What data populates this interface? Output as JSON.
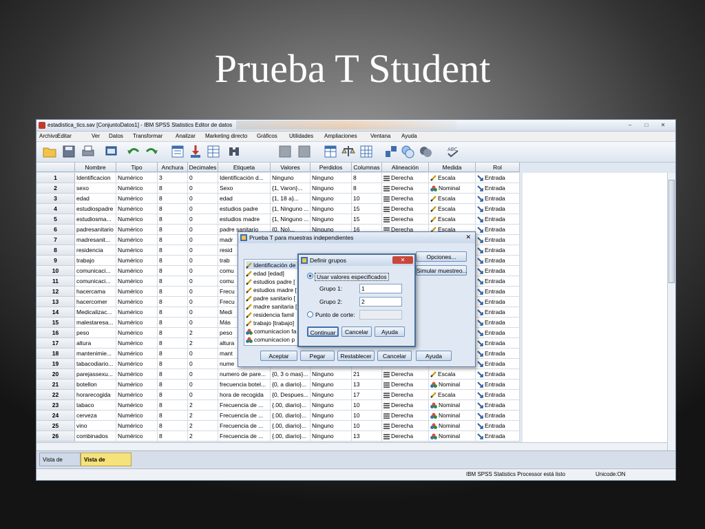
{
  "slide": {
    "title": "Prueba T Student"
  },
  "window": {
    "title": "estadistica_tics.sav [ConjuntoDatos1] - IBM SPSS Statistics Editor de datos",
    "controls": [
      "–",
      "□",
      "✕"
    ]
  },
  "menu": [
    "Archivo",
    "Editar",
    "Ver",
    "Datos",
    "Transformar",
    "Analizar",
    "Marketing directo",
    "Gráficos",
    "Utilidades",
    "Ampliaciones",
    "Ventana",
    "Ayuda"
  ],
  "toolbar": {
    "icons": [
      "open-folder-icon",
      "save-icon",
      "print-icon",
      "dialog-recall-icon",
      "undo-icon",
      "redo-icon",
      "goto-case-icon",
      "goto-variable-icon",
      "variables-icon",
      "find-icon",
      "insert-cases-icon",
      "insert-variable-icon",
      "split-file-icon",
      "weight-cases-icon",
      "select-cases-icon",
      "value-labels-icon",
      "use-sets-icon",
      "show-all-variables-icon",
      "spell-check-icon"
    ]
  },
  "grid": {
    "columns": [
      "Nombre",
      "Tipo",
      "Anchura",
      "Decimales",
      "Etiqueta",
      "Valores",
      "Perdidos",
      "Columnas",
      "Alineación",
      "Medida",
      "Rol"
    ],
    "rows": [
      [
        "1",
        "Identificacion",
        "Numérico",
        "3",
        "0",
        "Identificación d...",
        "Ninguno",
        "Ninguno",
        "8",
        "Derecha",
        "Escala",
        "Entrada"
      ],
      [
        "2",
        "sexo",
        "Numérico",
        "8",
        "0",
        "Sexo",
        "{1, Varon}...",
        "Ninguno",
        "8",
        "Derecha",
        "Nominal",
        "Entrada"
      ],
      [
        "3",
        "edad",
        "Numérico",
        "8",
        "0",
        "edad",
        "{1, 18 a}...",
        "Ninguno",
        "10",
        "Derecha",
        "Escala",
        "Entrada"
      ],
      [
        "4",
        "estudiospadre",
        "Numérico",
        "8",
        "0",
        "estudios padre",
        "{1, Ninguno ...",
        "Ninguno",
        "15",
        "Derecha",
        "Escala",
        "Entrada"
      ],
      [
        "5",
        "estudiosma...",
        "Numérico",
        "8",
        "0",
        "estudios madre",
        "{1, Ninguno ...",
        "Ninguno",
        "15",
        "Derecha",
        "Escala",
        "Entrada"
      ],
      [
        "6",
        "padresanitario",
        "Numérico",
        "8",
        "0",
        "padre sanitario",
        "{0, No}...",
        "Ninguno",
        "16",
        "Derecha",
        "Escala",
        "Entrada"
      ],
      [
        "7",
        "madresanit...",
        "Numérico",
        "8",
        "0",
        "madr",
        "",
        "",
        "",
        "",
        "",
        "Entrada"
      ],
      [
        "8",
        "residencia",
        "Numérico",
        "8",
        "0",
        "resid",
        "",
        "",
        "",
        "",
        "",
        "Entrada"
      ],
      [
        "9",
        "trabajo",
        "Numérico",
        "8",
        "0",
        "trab",
        "",
        "",
        "",
        "",
        "",
        "Entrada"
      ],
      [
        "10",
        "comunicaci...",
        "Numérico",
        "8",
        "0",
        "comu",
        "",
        "",
        "",
        "",
        "",
        "Entrada"
      ],
      [
        "11",
        "comunicaci...",
        "Numérico",
        "8",
        "0",
        "comu",
        "",
        "",
        "",
        "",
        "",
        "Entrada"
      ],
      [
        "12",
        "hacercama",
        "Numérico",
        "8",
        "0",
        "Frecu",
        "",
        "",
        "",
        "",
        "",
        "Entrada"
      ],
      [
        "13",
        "hacercomer",
        "Numérico",
        "8",
        "0",
        "Frecu",
        "",
        "",
        "",
        "",
        "",
        "Entrada"
      ],
      [
        "14",
        "Medicalizac...",
        "Numérico",
        "8",
        "0",
        "Medi",
        "",
        "",
        "",
        "",
        "",
        "Entrada"
      ],
      [
        "15",
        "malestaresa...",
        "Numérico",
        "8",
        "0",
        "Más",
        "",
        "",
        "",
        "",
        "",
        "Entrada"
      ],
      [
        "16",
        "peso",
        "Numérico",
        "8",
        "2",
        "peso",
        "",
        "",
        "",
        "",
        "",
        "Entrada"
      ],
      [
        "17",
        "altura",
        "Numérico",
        "8",
        "2",
        "altura",
        "",
        "",
        "",
        "",
        "",
        "Entrada"
      ],
      [
        "18",
        "mantenimie...",
        "Numérico",
        "8",
        "0",
        "mant",
        "",
        "",
        "",
        "",
        "",
        "Entrada"
      ],
      [
        "19",
        "tabacodiario...",
        "Numérico",
        "8",
        "0",
        "nume",
        "",
        "",
        "",
        "",
        "",
        "Entrada"
      ],
      [
        "20",
        "parejassexu...",
        "Numérico",
        "8",
        "0",
        "numero de pare...",
        "{0, 3 o mas}...",
        "Ninguno",
        "21",
        "Derecha",
        "Escala",
        "Entrada"
      ],
      [
        "21",
        "botellon",
        "Numérico",
        "8",
        "0",
        "frecuencia botel...",
        "{0, a diario}...",
        "Ninguno",
        "13",
        "Derecha",
        "Nominal",
        "Entrada"
      ],
      [
        "22",
        "horarecogida",
        "Numérico",
        "8",
        "0",
        "hora de recogida",
        "{0, Despues...",
        "Ninguno",
        "17",
        "Derecha",
        "Escala",
        "Entrada"
      ],
      [
        "23",
        "tabaco",
        "Numérico",
        "8",
        "2",
        "Frecuencia de ...",
        "{.00, diario}...",
        "Ninguno",
        "10",
        "Derecha",
        "Nominal",
        "Entrada"
      ],
      [
        "24",
        "cerveza",
        "Numérico",
        "8",
        "2",
        "Frecuencia de ...",
        "{.00, diario}...",
        "Ninguno",
        "10",
        "Derecha",
        "Nominal",
        "Entrada"
      ],
      [
        "25",
        "vino",
        "Numérico",
        "8",
        "2",
        "Frecuencia de ...",
        "{.00, diario}...",
        "Ninguno",
        "10",
        "Derecha",
        "Nominal",
        "Entrada"
      ],
      [
        "26",
        "combinados",
        "Numérico",
        "8",
        "2",
        "Frecuencia de ...",
        "{.00, diario}...",
        "Ninguno",
        "13",
        "Derecha",
        "Nominal",
        "Entrada"
      ]
    ]
  },
  "tabs": [
    "Vista de datos",
    "Vista de variables"
  ],
  "active_tab": "Vista de variables",
  "status": {
    "processor": "IBM SPSS Statistics Processor está listo",
    "unicode": "Unicode:ON"
  },
  "ttest_dialog": {
    "title": "Prueba T para muestras independientes",
    "variables": [
      "Identificación de ...",
      "edad [edad]",
      "estudios padre [",
      "estudios madre [",
      "padre sanitario [",
      "madre sanitaria [",
      "residencia famil",
      "trabajo [trabajo]",
      "comunicacion fa",
      "comunicacion p"
    ],
    "buttons_right": [
      "Opciones...",
      "Simular muestreo..."
    ],
    "buttons_bottom": [
      "Aceptar",
      "Pegar",
      "Restablecer",
      "Cancelar",
      "Ayuda"
    ]
  },
  "groups_dialog": {
    "title": "Definir grupos",
    "option_specified": "Usar valores especificados",
    "group1_label": "Grupo 1:",
    "group1_value": "1",
    "group2_label": "Grupo 2:",
    "group2_value": "2",
    "option_cutpoint": "Punto de corte:",
    "buttons": [
      "Continuar",
      "Cancelar",
      "Ayuda"
    ]
  },
  "colors": {
    "accent": "#2f5f9e",
    "tab_active": "#f6e27a",
    "close_red": "#c9473a"
  }
}
